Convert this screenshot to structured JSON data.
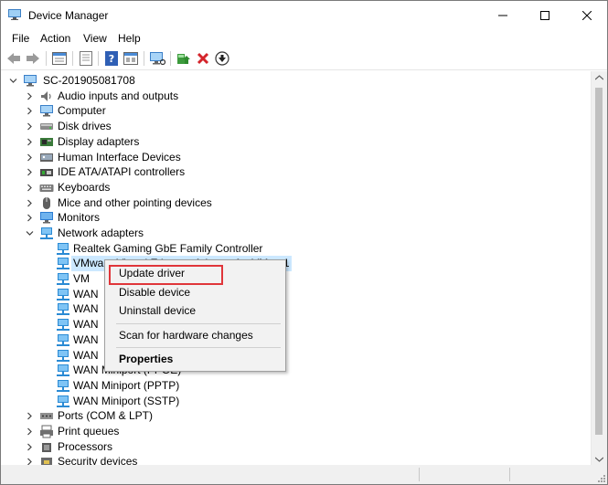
{
  "window": {
    "title": "Device Manager",
    "controls": {
      "minimize": "—",
      "maximize": "☐",
      "close": "✕"
    }
  },
  "menu": [
    "File",
    "Action",
    "View",
    "Help"
  ],
  "toolbar": {
    "icons": [
      "back-icon",
      "forward-icon",
      "properties-icon",
      "view-icon",
      "help-icon",
      "show-hidden-icon",
      "monitor-icon",
      "update-driver-icon",
      "uninstall-icon",
      "disable-icon"
    ]
  },
  "tree": {
    "root": "SC-201905081708",
    "categories": [
      "Audio inputs and outputs",
      "Computer",
      "Disk drives",
      "Display adapters",
      "Human Interface Devices",
      "IDE ATA/ATAPI controllers",
      "Keyboards",
      "Mice and other pointing devices",
      "Monitors",
      "Network adapters"
    ],
    "network_children": [
      "Realtek Gaming GbE Family Controller",
      "VMware Virtual Ethernet Adapter for VMnet1",
      "VM",
      "WAN",
      "WAN",
      "WAN",
      "WAN",
      "WAN",
      "WAN Miniport (PPOE)",
      "WAN Miniport (PPTP)",
      "WAN Miniport (SSTP)"
    ],
    "more_categories": [
      "Ports (COM & LPT)",
      "Print queues",
      "Processors",
      "Security devices"
    ]
  },
  "context_menu": {
    "items": [
      "Update driver",
      "Disable device",
      "Uninstall device",
      "Scan for hardware changes",
      "Properties"
    ]
  },
  "colors": {
    "selection": "#cce8ff",
    "highlight_box": "#e0353a",
    "network_icon": "#2a8ad4"
  }
}
